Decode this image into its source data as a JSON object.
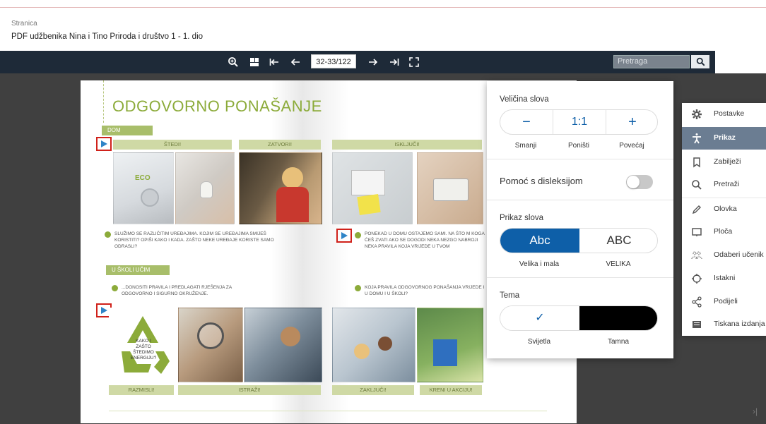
{
  "breadcrumb": "Stranica",
  "document_title": "PDF udžbenika Nina i Tino Priroda i društvo 1 - 1. dio",
  "toolbar": {
    "page_indicator": "32-33/122",
    "search_placeholder": "Pretraga",
    "icons": [
      "zoom-in-icon",
      "grid-icon",
      "first-page-icon",
      "prev-page-icon",
      "next-page-icon",
      "last-page-icon",
      "fullscreen-icon",
      "search-icon"
    ]
  },
  "book": {
    "title": "ODGOVORNO PONAŠANJE",
    "tag_dom": "DOM",
    "tag_skola": "U ŠKOLI UČIM",
    "headers_top": [
      "ŠTEDI!",
      "ZATVORI!",
      "ISKLJUČI!"
    ],
    "headers_bottom": [
      "RAZMISLI!",
      "ISTRAŽI!",
      "ZAKLJUČI!",
      "KRENI U AKCIJU!"
    ],
    "eco_label": "ECO",
    "recycle_text": "KAKO I ZAŠTO ŠTEDIMO ENERGIJU?",
    "caption_1": "SLUŽIMO SE RAZLIČITIM UREĐAJIMA. KOJIM SE UREĐAJIMA SMIJEŠ KORISTITI? OPIŠI KAKO I KADA. ZAŠTO NEKE UREĐAJE KORISTE SAMO ODRASLI?",
    "caption_2": "PONEKAD U DOMU OSTAJEMO SAMI. NA ŠTO M KOGA ĆEŠ ZVATI AKO SE DOGODI NEKA NEZGO NABROJI NEKA PRAVILA KOJA VRIJEDE U TVOM",
    "caption_3": "...DONOSITI PRAVILA I PREDLAGATI RJEŠENJA ZA ODGOVORNO I SIGURNO OKRUŽENJE.",
    "caption_4": "KOJA PRAVILA ODGOVORNOG PONAŠANJA VRIJEDE I U DOMU I U ŠKOLI?"
  },
  "settings": {
    "font_size_label": "Veličina slova",
    "decrease_symbol": "−",
    "reset_symbol": "1:1",
    "increase_symbol": "+",
    "decrease_label": "Smanji",
    "reset_label": "Poništi",
    "increase_label": "Povećaj",
    "dyslexia_label": "Pomoć s disleksijom",
    "dyslexia_on": false,
    "font_display_label": "Prikaz slova",
    "case_mixed_symbol": "Abc",
    "case_upper_symbol": "ABC",
    "case_mixed_label": "Velika i mala",
    "case_upper_label": "VELIKA",
    "theme_label": "Tema",
    "theme_light_label": "Svijetla",
    "theme_dark_label": "Tamna",
    "selected_check": "✓"
  },
  "sidebar": {
    "items": [
      {
        "label": "Postavke",
        "icon": "gear-icon"
      },
      {
        "label": "Prikaz",
        "icon": "accessibility-icon",
        "active": true
      },
      {
        "label": "Zabilježi",
        "icon": "bookmark-icon"
      },
      {
        "label": "Pretraži",
        "icon": "search-icon"
      },
      {
        "label": "Olovka",
        "icon": "pencil-icon"
      },
      {
        "label": "Ploča",
        "icon": "board-icon"
      },
      {
        "label": "Odaberi učenik",
        "icon": "students-icon"
      },
      {
        "label": "Istakni",
        "icon": "crosshair-icon"
      },
      {
        "label": "Podijeli",
        "icon": "share-icon"
      },
      {
        "label": "Tiskana izdanja",
        "icon": "print-edition-icon"
      }
    ]
  },
  "colors": {
    "toolbar": "#1e2a38",
    "viewer_bg": "#404040",
    "accent_blue": "#0e5fa8",
    "book_green": "#8cab3a",
    "sidebar_active": "#6b7d92"
  }
}
